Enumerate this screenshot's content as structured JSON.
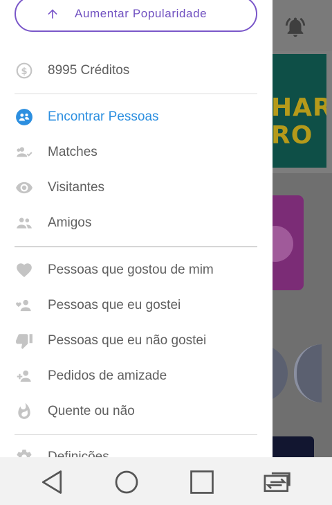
{
  "drawer": {
    "popularity_button": "Aumentar Popularidade",
    "credits": "8995 Créditos",
    "nav_items": [
      {
        "label": "Encontrar Pessoas",
        "icon": "people-icon",
        "active": true
      },
      {
        "label": "Matches",
        "icon": "matches-icon"
      },
      {
        "label": "Visitantes",
        "icon": "eye-icon"
      },
      {
        "label": "Amigos",
        "icon": "friends-icon"
      }
    ],
    "activity_items": [
      {
        "label": "Pessoas que gostou de mim",
        "icon": "heart-icon"
      },
      {
        "label": "Pessoas que eu gostei",
        "icon": "person-heart-icon"
      },
      {
        "label": "Pessoas que eu não gostei",
        "icon": "thumb-down-icon"
      },
      {
        "label": "Pedidos de amizade",
        "icon": "add-person-icon"
      },
      {
        "label": "Quente ou não",
        "icon": "flame-icon"
      }
    ],
    "settings_label": "Definições"
  },
  "background": {
    "banner_text_line1": "HAR",
    "banner_text_line2": "RO"
  },
  "colors": {
    "accent_purple": "#7a57c9",
    "active_blue": "#2c8fe0",
    "icon_grey": "#c4c4c4",
    "text_grey": "#5f5f5f"
  }
}
